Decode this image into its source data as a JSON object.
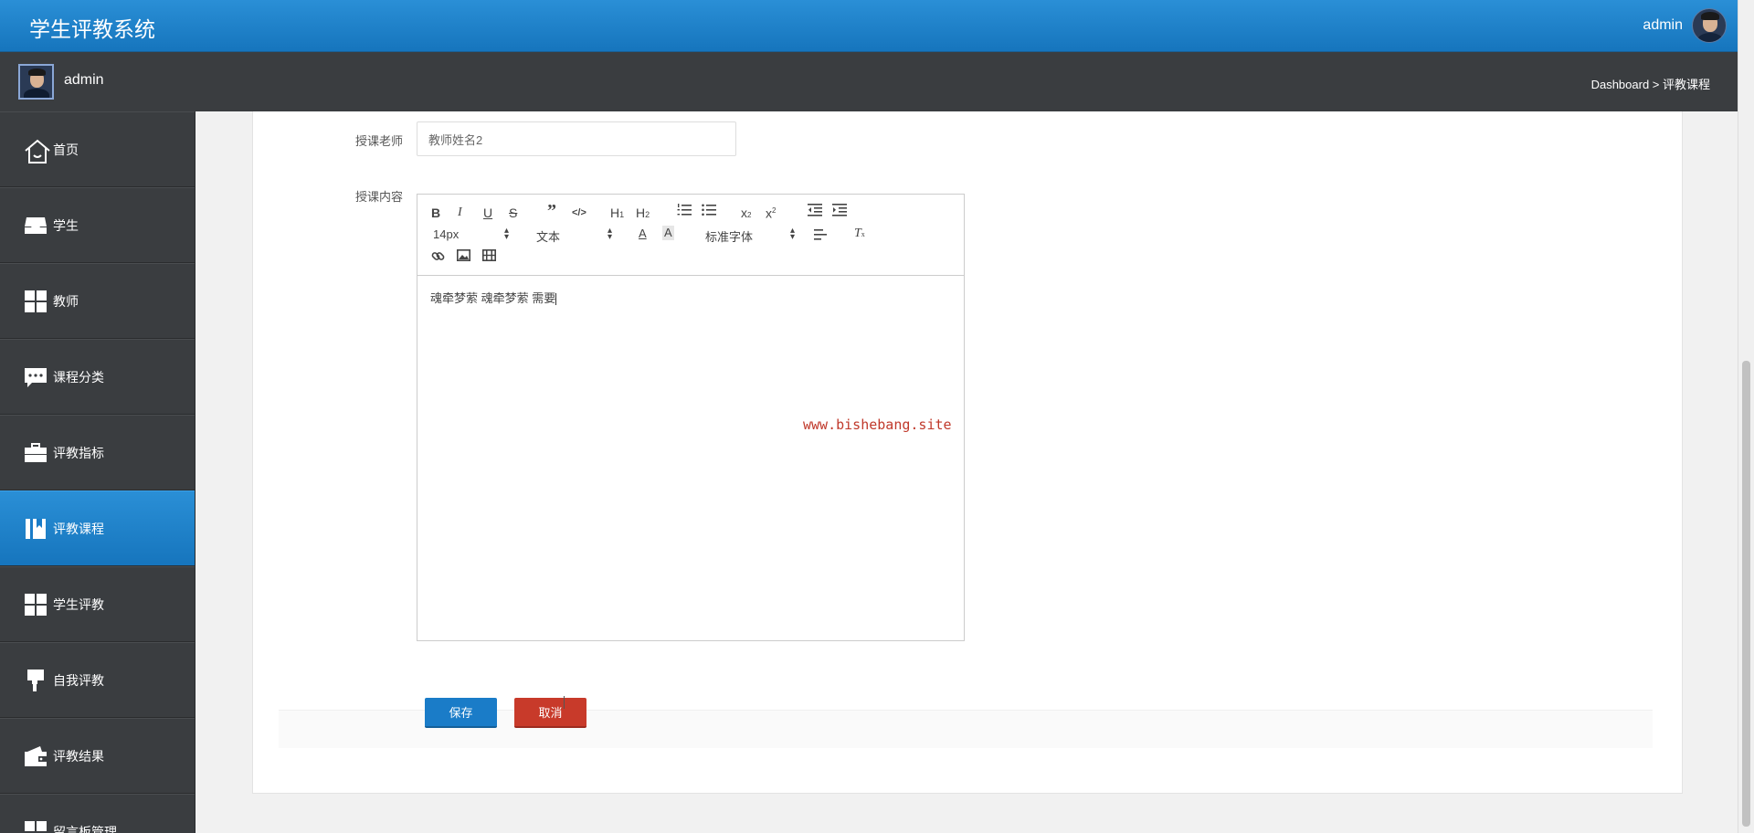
{
  "app": {
    "title": "学生评教系统"
  },
  "header": {
    "user_name": "admin"
  },
  "subheader": {
    "user_name": "admin",
    "breadcrumb": "Dashboard > 评教课程"
  },
  "sidebar": {
    "items": [
      {
        "label": "首页",
        "icon": "home-icon"
      },
      {
        "label": "学生",
        "icon": "inbox-icon"
      },
      {
        "label": "教师",
        "icon": "grid-icon"
      },
      {
        "label": "课程分类",
        "icon": "chat-icon"
      },
      {
        "label": "评教指标",
        "icon": "briefcase-icon"
      },
      {
        "label": "评教课程",
        "icon": "book-icon",
        "active": true
      },
      {
        "label": "学生评教",
        "icon": "grid-icon"
      },
      {
        "label": "自我评教",
        "icon": "brush-icon"
      },
      {
        "label": "评教结果",
        "icon": "wallet-icon"
      },
      {
        "label": "留言板管理",
        "icon": "grid-icon"
      }
    ]
  },
  "form": {
    "teacher_label": "授课老师",
    "teacher_value": "教师姓名2",
    "content_label": "授课内容",
    "editor": {
      "font_size": "14px",
      "block_type": "文本",
      "font_family": "标准字体",
      "content": "魂牵梦萦 魂牵梦萦 需要"
    },
    "save_label": "保存",
    "cancel_label": "取消"
  },
  "watermark": "www.bishebang.site",
  "colors": {
    "header": "#1a7cc8",
    "sidebar": "#3a3d40",
    "save": "#1a7cc8",
    "cancel": "#c83a2a"
  }
}
